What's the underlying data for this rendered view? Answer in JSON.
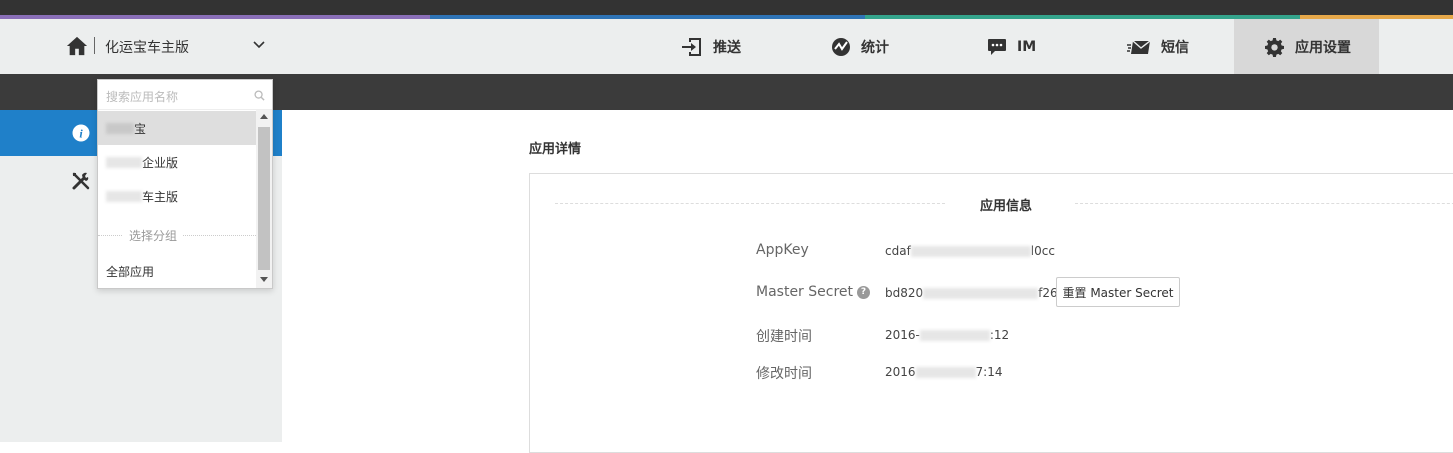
{
  "header": {
    "app_name": "化运宝车主版",
    "stripe_colors": [
      "#8a6fb8",
      "#2f74b6",
      "#34a48c",
      "#e6a84a"
    ],
    "nav": [
      {
        "label": "推送",
        "icon": "push-icon"
      },
      {
        "label": "统计",
        "icon": "stats-icon"
      },
      {
        "label": "IM",
        "icon": "im-icon"
      },
      {
        "label": "短信",
        "icon": "sms-icon"
      },
      {
        "label": "应用设置",
        "icon": "gear-icon",
        "active": true
      }
    ]
  },
  "sidebar": {
    "items": [
      {
        "icon": "info-icon",
        "active": true
      },
      {
        "icon": "tools-icon",
        "active": false
      }
    ],
    "accent_color": "#1f80c9"
  },
  "dropdown": {
    "search_placeholder": "搜索应用名称",
    "items": [
      {
        "label_visible": "宝",
        "highlighted": true
      },
      {
        "label_visible": "企业版",
        "highlighted": false
      },
      {
        "label_visible": "车主版",
        "highlighted": false
      }
    ],
    "group_label": "选择分组",
    "all_apps": "全部应用"
  },
  "main": {
    "section_title": "应用详情",
    "panel_title": "应用信息",
    "rows": {
      "appkey": {
        "label": "AppKey",
        "value_start": "cdaf",
        "value_end": "l0cc"
      },
      "master_secret": {
        "label": "Master Secret",
        "help": "?",
        "value_start": "bd820",
        "value_end": "f26"
      },
      "created": {
        "label": "创建时间",
        "value_start": "2016-",
        "value_end": ":12"
      },
      "modified": {
        "label": "修改时间",
        "value_start": "2016",
        "value_end": "7:14"
      }
    },
    "reset_button": "重置 Master Secret"
  }
}
